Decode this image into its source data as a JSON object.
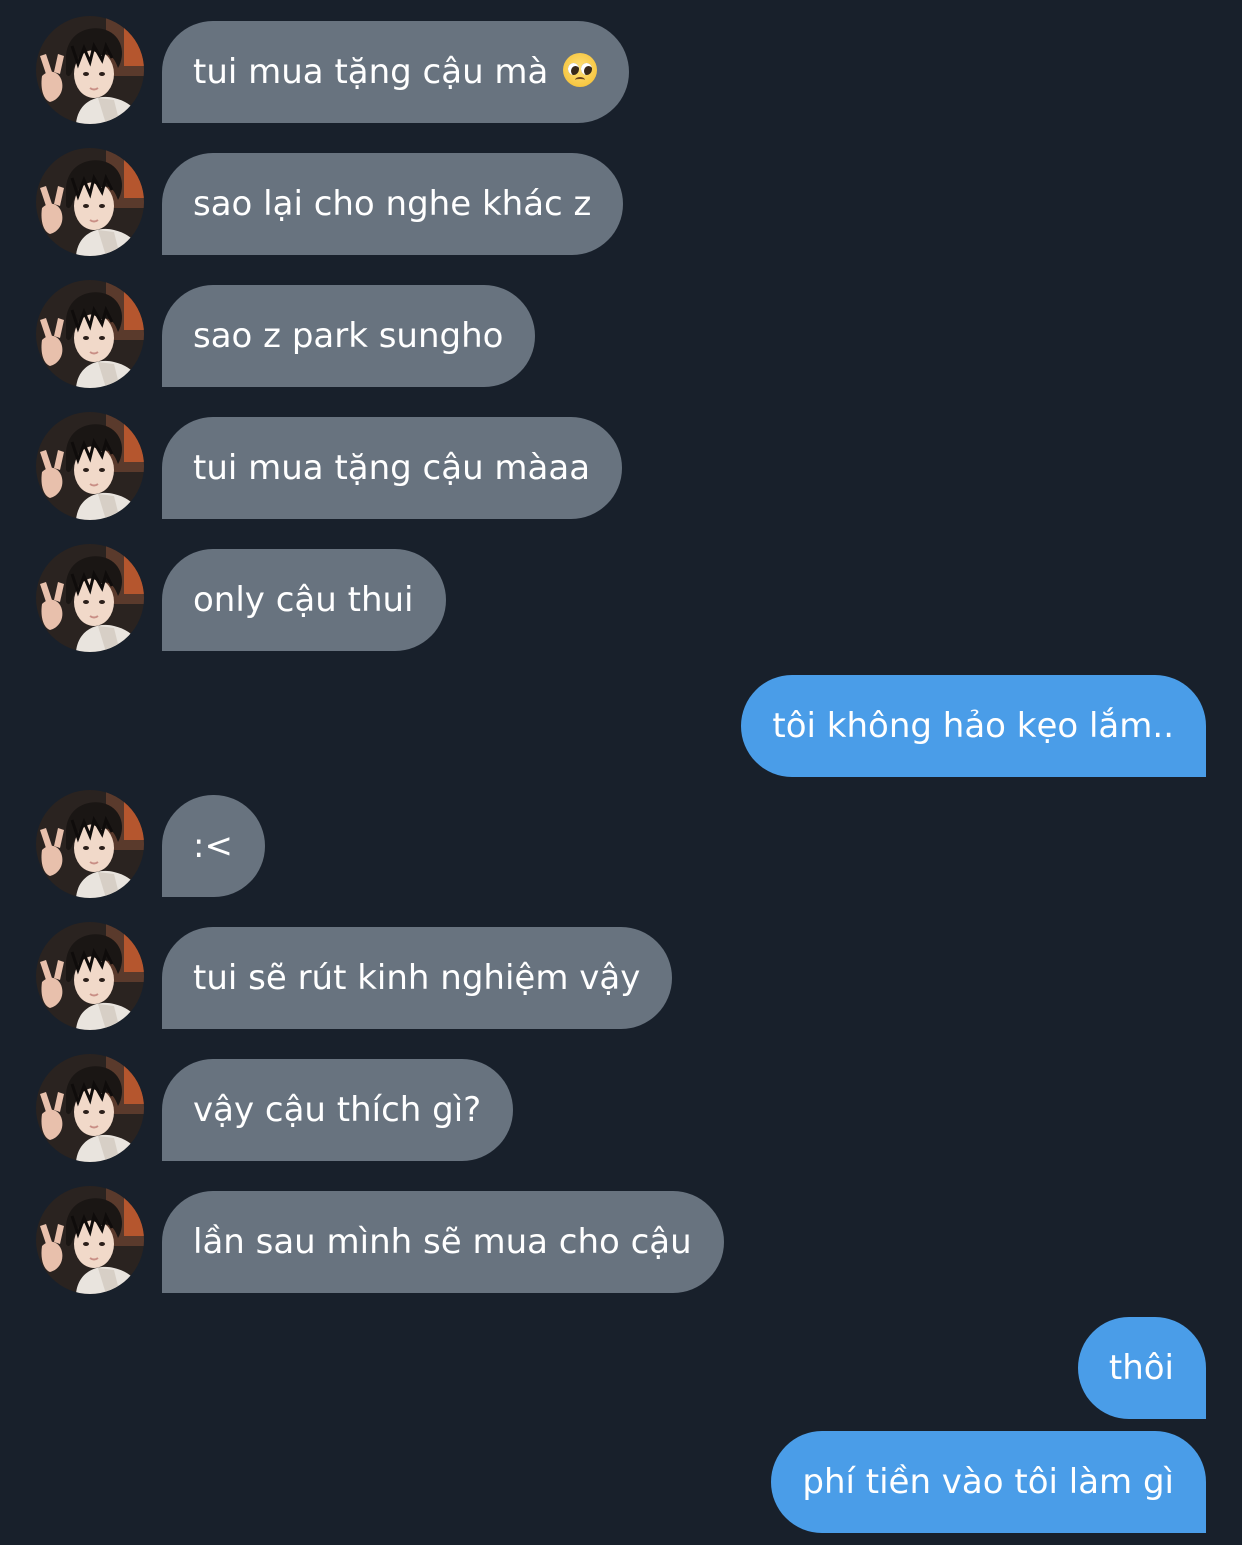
{
  "conversation": {
    "messages": [
      {
        "side": "in",
        "text": "tui mua tặng cậu mà",
        "emoji": "pleading-face-emoji"
      },
      {
        "side": "in",
        "text": "sao lại cho nghe khác z"
      },
      {
        "side": "in",
        "text": "sao z park sungho"
      },
      {
        "side": "in",
        "text": "tui mua tặng cậu màaa"
      },
      {
        "side": "in",
        "text": "only cậu thui"
      },
      {
        "side": "out",
        "text": "tôi không hảo kẹo lắm.."
      },
      {
        "side": "in",
        "text": ":<"
      },
      {
        "side": "in",
        "text": "tui sẽ rút kinh nghiệm vậy"
      },
      {
        "side": "in",
        "text": "vậy cậu thích gì?"
      },
      {
        "side": "in",
        "text": "lần sau mình sẽ mua cho cậu"
      },
      {
        "side": "out",
        "text": "thôi"
      },
      {
        "side": "out",
        "text": "phí tiền vào tôi làm gì"
      }
    ]
  },
  "colors": {
    "background": "#18202b",
    "incoming_bubble": "#68737f",
    "outgoing_bubble": "#4a9de8",
    "text": "#ffffff"
  }
}
